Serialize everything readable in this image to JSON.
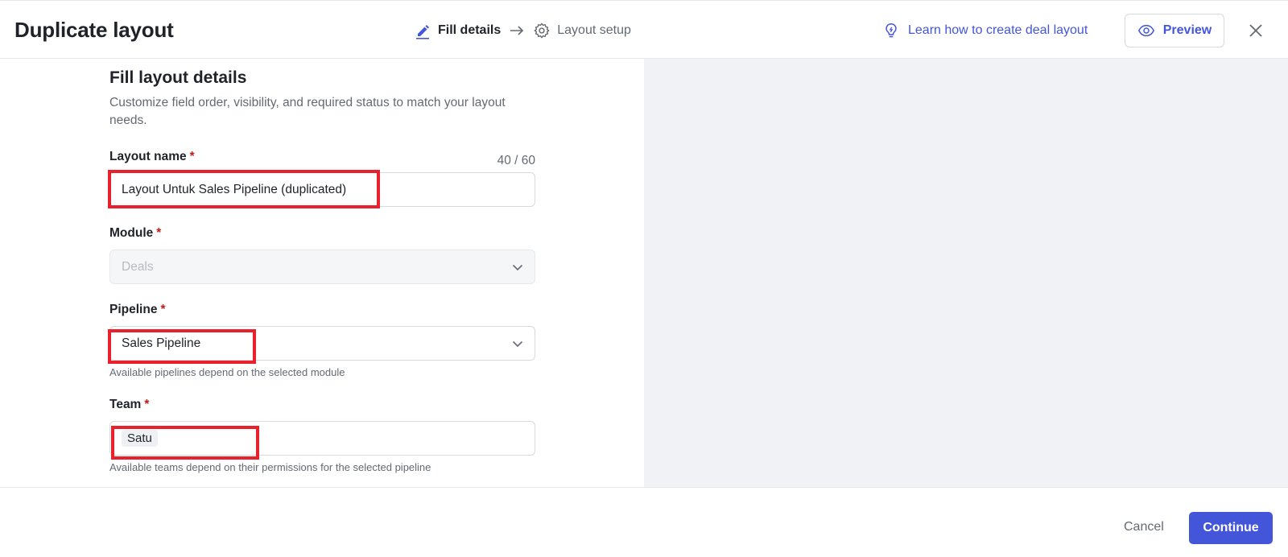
{
  "header": {
    "title": "Duplicate layout",
    "steps": [
      {
        "label": "Fill details",
        "state": "active",
        "icon": "pencil-icon"
      },
      {
        "label": "Layout setup",
        "state": "inactive",
        "icon": "gear-icon"
      }
    ],
    "learn_link": "Learn how to create deal layout",
    "preview_label": "Preview"
  },
  "form": {
    "title": "Fill layout details",
    "description": "Customize field order, visibility, and required status to match your layout needs.",
    "layout_name": {
      "label": "Layout name",
      "required_mark": "*",
      "value": "Layout Untuk Sales Pipeline (duplicated)",
      "counter": "40 / 60"
    },
    "module": {
      "label": "Module",
      "required_mark": "*",
      "value": "Deals"
    },
    "pipeline": {
      "label": "Pipeline",
      "required_mark": "*",
      "value": "Sales Pipeline",
      "helper": "Available pipelines depend on the selected module"
    },
    "team": {
      "label": "Team",
      "required_mark": "*",
      "value": "Satu",
      "helper": "Available teams depend on their permissions for the selected pipeline"
    }
  },
  "footer": {
    "cancel_label": "Cancel",
    "continue_label": "Continue"
  },
  "colors": {
    "accent": "#4356d9",
    "required": "#c21b1b",
    "highlight": "#e8212c",
    "panel_bg": "#f0f2f6"
  }
}
